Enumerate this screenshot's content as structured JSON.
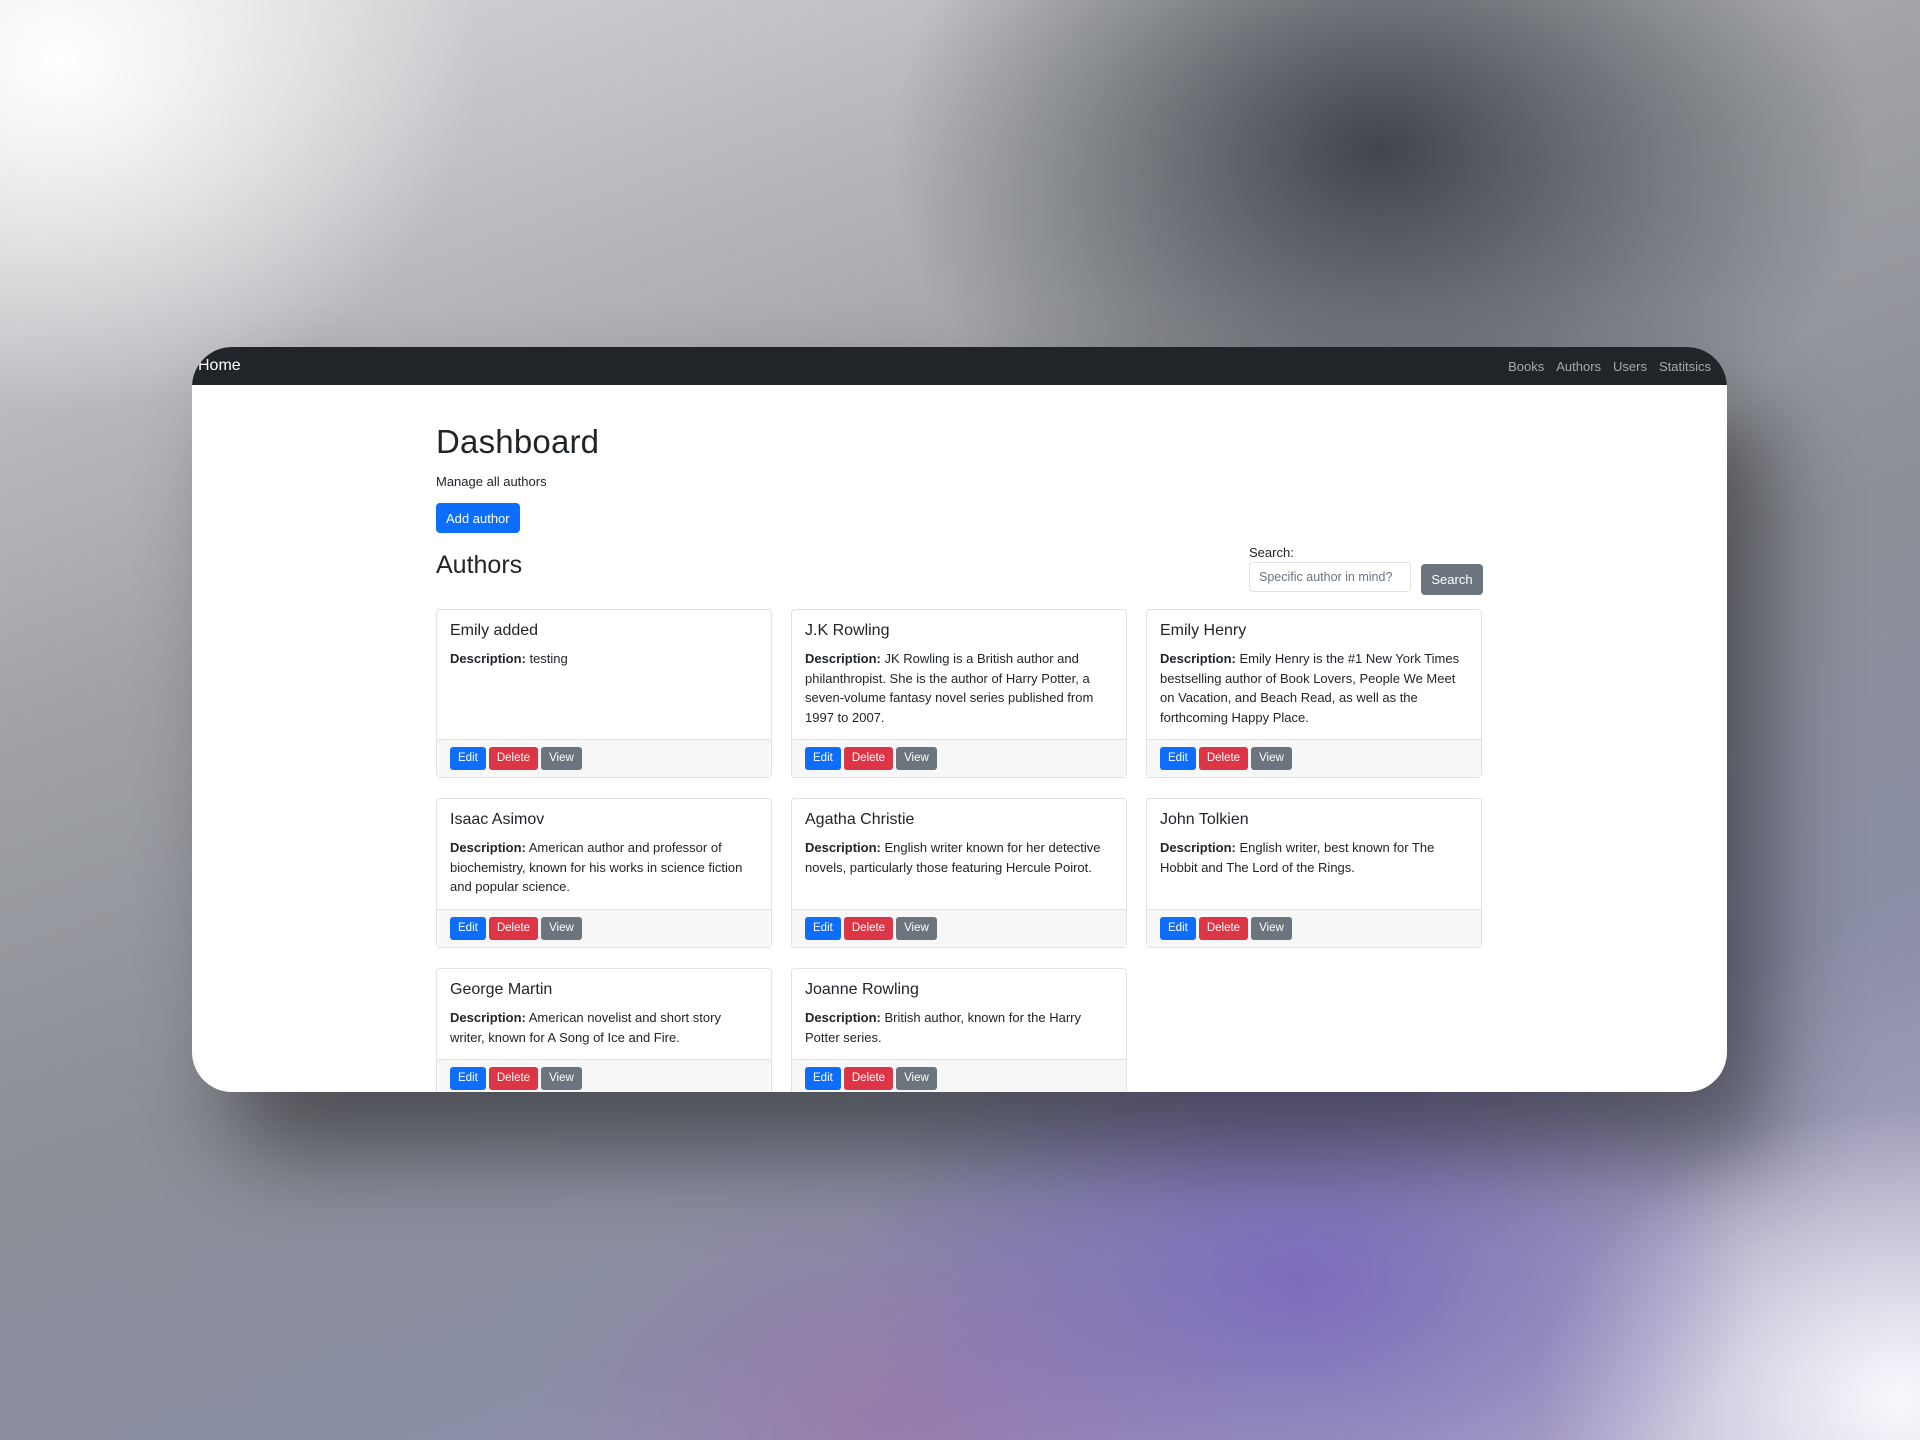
{
  "navbar": {
    "brand": "Home",
    "links": [
      "Books",
      "Authors",
      "Users",
      "Statitsics"
    ]
  },
  "header": {
    "title": "Dashboard",
    "subtitle": "Manage all authors",
    "add_button": "Add author"
  },
  "authors_section": {
    "title": "Authors",
    "search_label": "Search:",
    "search_placeholder": "Specific author in mind?",
    "search_button": "Search"
  },
  "card_labels": {
    "description_label": "Description:",
    "edit": "Edit",
    "delete": "Delete",
    "view": "View"
  },
  "authors": [
    {
      "name": "Emily added",
      "description": "testing"
    },
    {
      "name": "J.K Rowling",
      "description": "JK Rowling is a British author and philanthropist. She is the author of Harry Potter, a seven-volume fantasy novel series published from 1997 to 2007."
    },
    {
      "name": "Emily Henry",
      "description": "Emily Henry is the #1 New York Times bestselling author of Book Lovers, People We Meet on Vacation, and Beach Read, as well as the forthcoming Happy Place."
    },
    {
      "name": "Isaac Asimov",
      "description": "American author and professor of biochemistry, known for his works in science fiction and popular science."
    },
    {
      "name": "Agatha Christie",
      "description": "English writer known for her detective novels, particularly those featuring Hercule Poirot."
    },
    {
      "name": "John Tolkien",
      "description": "English writer, best known for The Hobbit and The Lord of the Rings."
    },
    {
      "name": "George Martin",
      "description": "American novelist and short story writer, known for A Song of Ice and Fire."
    },
    {
      "name": "Joanne Rowling",
      "description": "British author, known for the Harry Potter series."
    }
  ],
  "colors": {
    "navbar": "#212529",
    "primary": "#0d6efd",
    "danger": "#dc3545",
    "secondary": "#6c757d"
  }
}
